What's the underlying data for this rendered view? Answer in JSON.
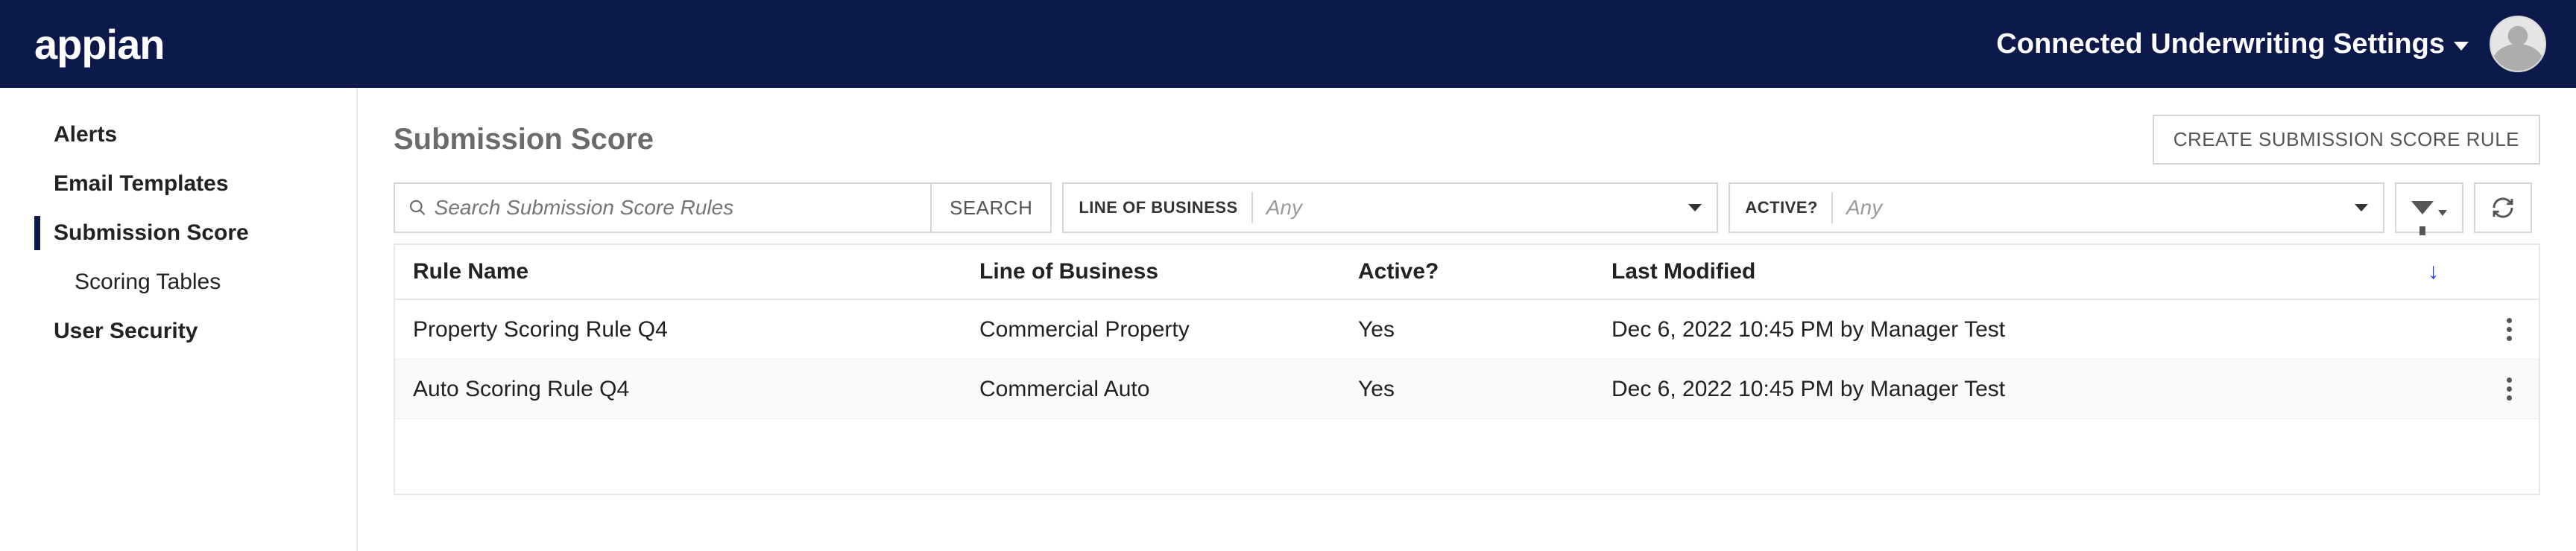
{
  "header": {
    "logo_text": "appian",
    "site_title": "Connected Underwriting Settings"
  },
  "sidebar": {
    "items": [
      {
        "label": "Alerts",
        "bold": true
      },
      {
        "label": "Email Templates",
        "bold": true
      },
      {
        "label": "Submission Score",
        "bold": true,
        "selected": true
      },
      {
        "label": "Scoring Tables",
        "sub": true
      },
      {
        "label": "User Security",
        "bold": true
      }
    ]
  },
  "page": {
    "title": "Submission Score",
    "create_button": "CREATE SUBMISSION SCORE RULE"
  },
  "filters": {
    "search_placeholder": "Search Submission Score Rules",
    "search_button": "SEARCH",
    "lob_label": "LINE OF BUSINESS",
    "lob_value": "Any",
    "active_label": "ACTIVE?",
    "active_value": "Any"
  },
  "table": {
    "columns": {
      "rule": "Rule Name",
      "lob": "Line of Business",
      "active": "Active?",
      "modified": "Last Modified"
    },
    "sort_indicator": "↓",
    "rows": [
      {
        "rule": "Property Scoring Rule Q4",
        "lob": "Commercial Property",
        "active": "Yes",
        "modified": "Dec 6, 2022 10:45 PM by Manager Test"
      },
      {
        "rule": "Auto Scoring Rule Q4",
        "lob": "Commercial Auto",
        "active": "Yes",
        "modified": "Dec 6, 2022 10:45 PM by Manager Test"
      }
    ]
  }
}
